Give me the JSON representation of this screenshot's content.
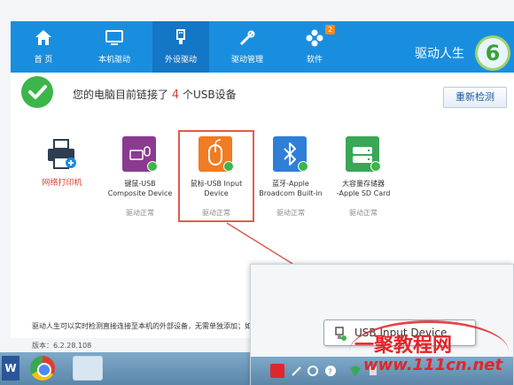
{
  "nav": {
    "items": [
      {
        "label": "首 页",
        "icon": "home-icon"
      },
      {
        "label": "本机驱动",
        "icon": "monitor-icon"
      },
      {
        "label": "外设驱动",
        "icon": "usb-icon",
        "active": true
      },
      {
        "label": "驱动管理",
        "icon": "tools-icon"
      },
      {
        "label": "软件",
        "icon": "apps-icon",
        "badge": "2"
      }
    ],
    "brand": "驱动人生",
    "logo_text": "6"
  },
  "status": {
    "prefix": "您的电脑目前链接了",
    "count": "4",
    "suffix": "个USB设备"
  },
  "redetect_label": "重新检测",
  "devices": [
    {
      "name": "网络打印机",
      "driver": "",
      "icon": "printer-icon",
      "color": "#ffffff"
    },
    {
      "name": "键鼠-USB\nComposite Device",
      "driver": "驱动正常",
      "icon": "keyboard-mouse-icon",
      "color": "#8a3b8f"
    },
    {
      "name": "鼠标-USB Input\nDevice",
      "driver": "驱动正常",
      "icon": "mouse-icon",
      "color": "#f07c24"
    },
    {
      "name": "蓝牙-Apple\nBroadcom Built-in",
      "driver": "驱动正常",
      "icon": "bluetooth-icon",
      "color": "#2f7fd6"
    },
    {
      "name": "大容量存储器\n-Apple SD Card",
      "driver": "驱动正常",
      "icon": "storage-icon",
      "color": "#3aa757"
    }
  ],
  "footer": {
    "description": "驱动人生可以实时检测直接连接至本机的外部设备，无需单独添加；如",
    "version": "版本：6.2.28.108"
  },
  "inset": {
    "tooltip": "USB Input Device"
  },
  "watermark": {
    "text": "一聚教程网",
    "url": "www.111cn.net"
  },
  "colors": {
    "toolbar": "#1a8ede",
    "accent_green": "#3cb54a",
    "highlight_red": "#e55b4b"
  }
}
